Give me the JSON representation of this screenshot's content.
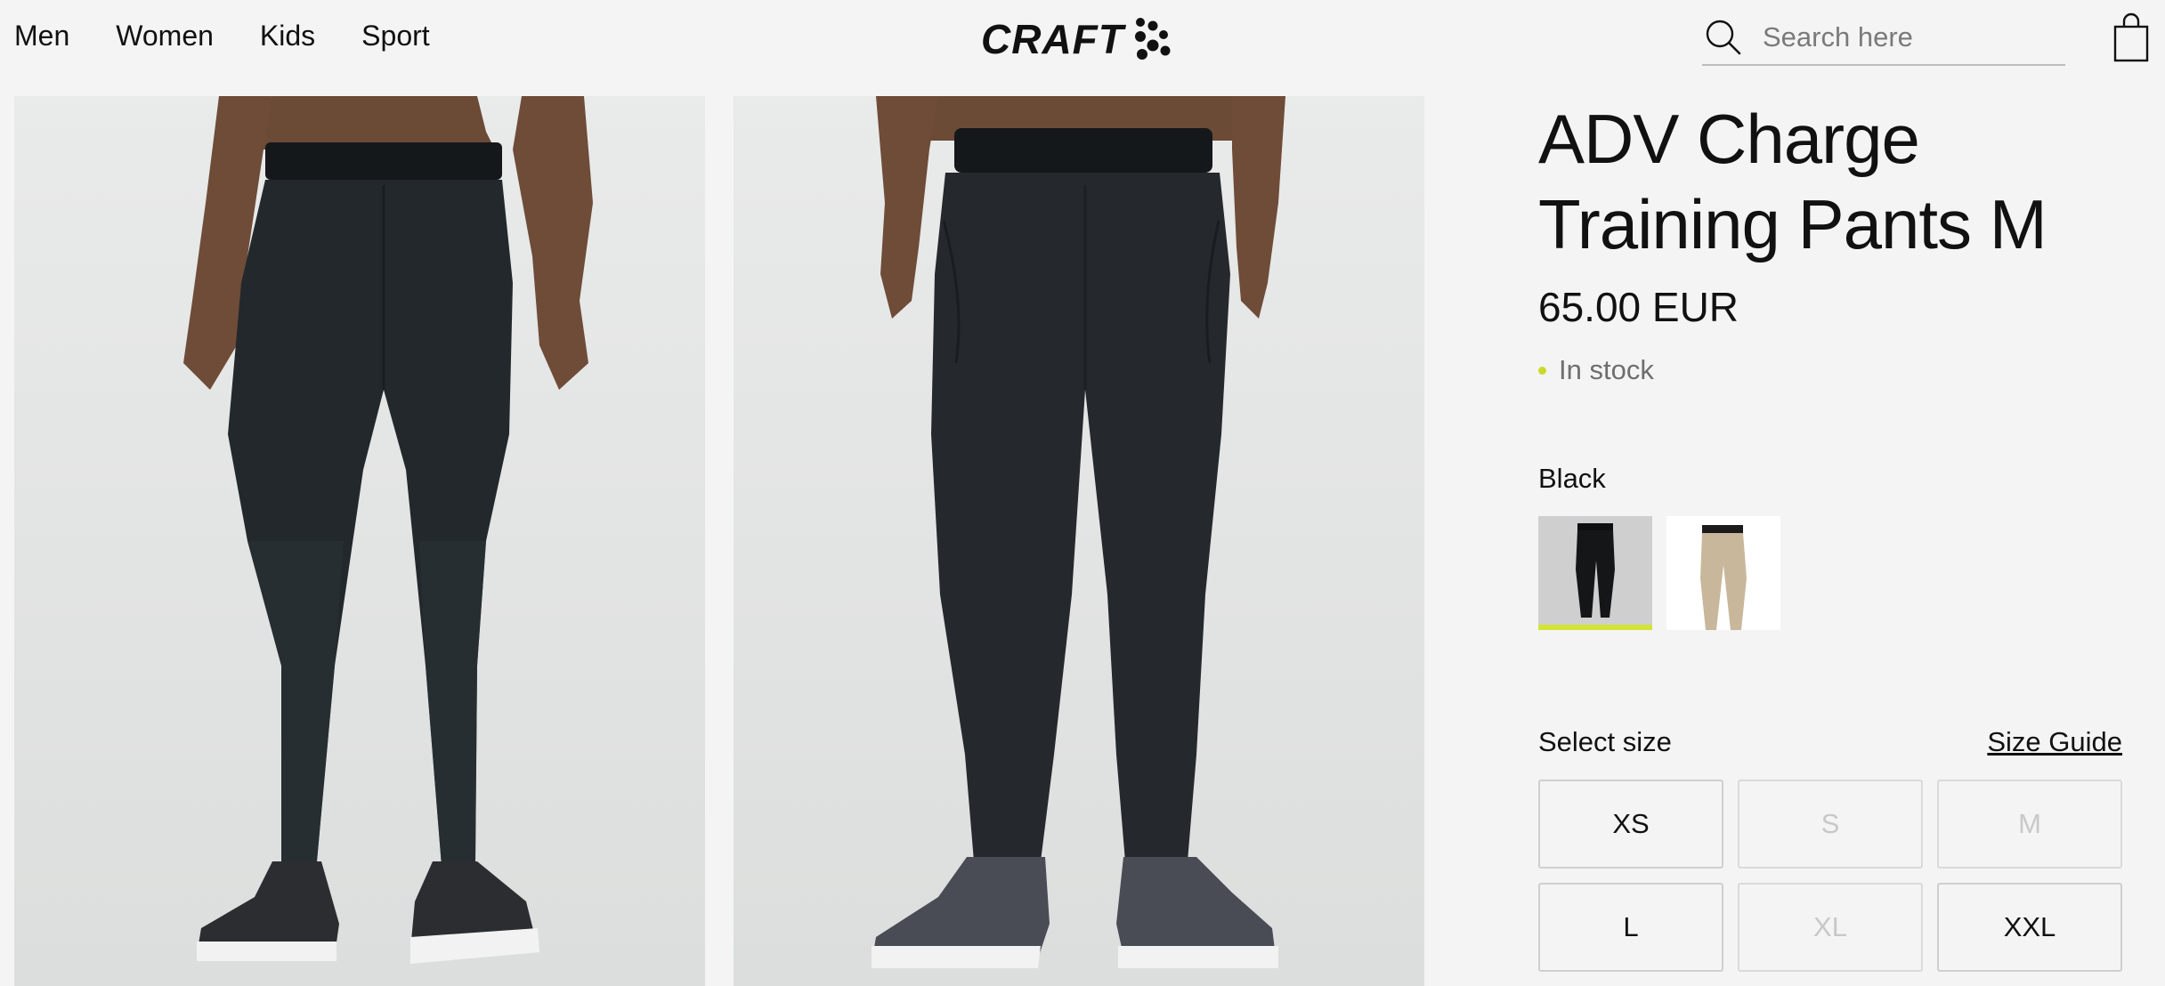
{
  "nav": {
    "items": [
      {
        "label": "Men"
      },
      {
        "label": "Women"
      },
      {
        "label": "Kids"
      },
      {
        "label": "Sport"
      }
    ]
  },
  "logo": {
    "text": "CRAFT"
  },
  "search": {
    "placeholder": "Search here",
    "value": "",
    "icon": "search-icon"
  },
  "cart": {
    "icon": "shopping-bag-icon"
  },
  "gallery": {
    "images": [
      {
        "alt": "Back view of black training pants"
      },
      {
        "alt": "Front view of black training pants"
      }
    ]
  },
  "product": {
    "title_line1": "ADV Charge",
    "title_line2": "Training Pants M",
    "price": "65.00 EUR",
    "stock_status": "In stock",
    "color_label": "Black",
    "colors": [
      {
        "name": "Black",
        "selected": true
      },
      {
        "name": "Beige",
        "selected": false
      }
    ],
    "size_label": "Select size",
    "size_guide": "Size Guide",
    "sizes": [
      {
        "label": "XS",
        "available": true
      },
      {
        "label": "S",
        "available": false
      },
      {
        "label": "M",
        "available": false
      },
      {
        "label": "L",
        "available": true
      },
      {
        "label": "XL",
        "available": false
      },
      {
        "label": "XXL",
        "available": true
      }
    ]
  },
  "colors": {
    "background": "#f4f4f4",
    "accent": "#d4e437",
    "text": "#111111",
    "muted": "#6e6e6e",
    "unavailable": "#c8c8c8"
  }
}
